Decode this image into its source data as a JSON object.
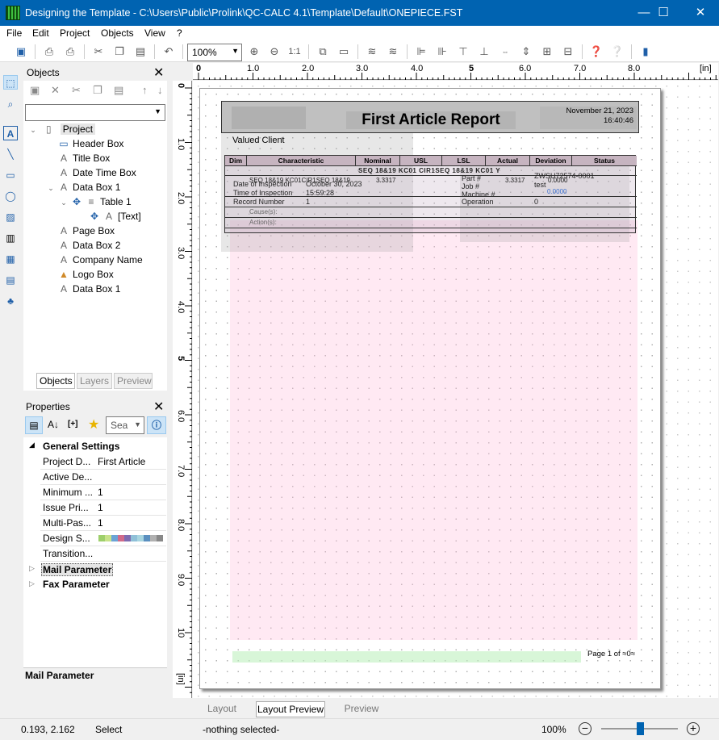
{
  "window": {
    "title": "Designing the Template - C:\\Users\\Public\\Prolink\\QC-CALC 4.1\\Template\\Default\\ONEPIECE.FST",
    "minimize": "—",
    "maximize": "☐",
    "close": "✕"
  },
  "menu": [
    "File",
    "Edit",
    "Project",
    "Objects",
    "View",
    "?"
  ],
  "toolbar": {
    "zoom": "100%"
  },
  "objects_panel": {
    "title": "Objects",
    "tree": [
      {
        "label": "Project",
        "icon": "page-icon"
      },
      {
        "label": "Header Box",
        "icon": "rect-icon"
      },
      {
        "label": "Title Box",
        "icon": "text-icon"
      },
      {
        "label": "Date Time Box",
        "icon": "text-icon"
      },
      {
        "label": "Data Box 1",
        "icon": "text-icon"
      },
      {
        "label": "Table 1",
        "icon": "table-icon"
      },
      {
        "label": "[Text]",
        "icon": "text-icon"
      },
      {
        "label": "Page Box",
        "icon": "text-icon"
      },
      {
        "label": "Data Box 2",
        "icon": "text-icon"
      },
      {
        "label": "Company Name",
        "icon": "text-icon"
      },
      {
        "label": "Logo Box",
        "icon": "image-icon"
      },
      {
        "label": "Data Box 1",
        "icon": "text-icon"
      }
    ],
    "tabs": [
      "Objects",
      "Layers",
      "Preview"
    ]
  },
  "properties_panel": {
    "title": "Properties",
    "search_placeholder": "Sea",
    "section_general": "General Settings",
    "rows": [
      {
        "key": "Project D...",
        "value": "First Article"
      },
      {
        "key": "Active De...",
        "value": ""
      },
      {
        "key": "Minimum ...",
        "value": "1"
      },
      {
        "key": "Issue Pri...",
        "value": "1"
      },
      {
        "key": "Multi-Pas...",
        "value": "1"
      },
      {
        "key": "Design S...",
        "value": ""
      },
      {
        "key": "Transition...",
        "value": ""
      }
    ],
    "section_mail": "Mail Parameter",
    "section_fax": "Fax Parameter",
    "description_title": "Mail Parameter"
  },
  "ruler": {
    "unit": "[in]",
    "h_labels": [
      "0",
      "1.0",
      "2.0",
      "3.0",
      "4.0",
      "5",
      "6.0",
      "7.0",
      "8.0"
    ],
    "v_labels": [
      "0",
      "1.0",
      "2.0",
      "3.0",
      "4.0",
      "5",
      "6.0",
      "7.0",
      "8.0",
      "9.0",
      "10",
      "[in]"
    ]
  },
  "report": {
    "title": "First Article Report",
    "date": "November 21, 2023",
    "time": "16:40:46",
    "client": "Valued Client",
    "columns": [
      "Dim",
      "Characteristic",
      "Nominal",
      "USL",
      "LSL",
      "Actual",
      "Deviation",
      "Status"
    ],
    "seq_row": "SEQ 18&19 KC01 CIR1SEQ 18&19 KC01 Y",
    "row1_char": "SEQ 18&19 KC01CIR1SEQ 18&19",
    "nominal_val": "3.3317",
    "actual_val": "3.3317",
    "dev_val": "0.0000",
    "dev_val2": "0.0000",
    "date_insp_label": "Date of Inspection",
    "date_insp_value": "October 30, 2023",
    "time_insp_label": "Time of Inspection",
    "time_insp_value": "15:59:28",
    "record_label": "Record Number",
    "record_value": "1",
    "part_label": "Part #",
    "part_value": "ZWSU72574-0001",
    "job_label": "Job #",
    "job_value": "test",
    "machine_label": "Machine #",
    "operation_label": "Operation",
    "operation_value": "0",
    "cause_label": "Cause(s):",
    "action_label": "Action(s):",
    "page_text": "Page 1 of ≈0≈"
  },
  "bottom_tabs": [
    "Layout",
    "Layout Preview",
    "Preview"
  ],
  "status": {
    "coords": "0.193, 2.162",
    "mode": "Select",
    "selection": "-nothing selected-",
    "zoom": "100%"
  }
}
